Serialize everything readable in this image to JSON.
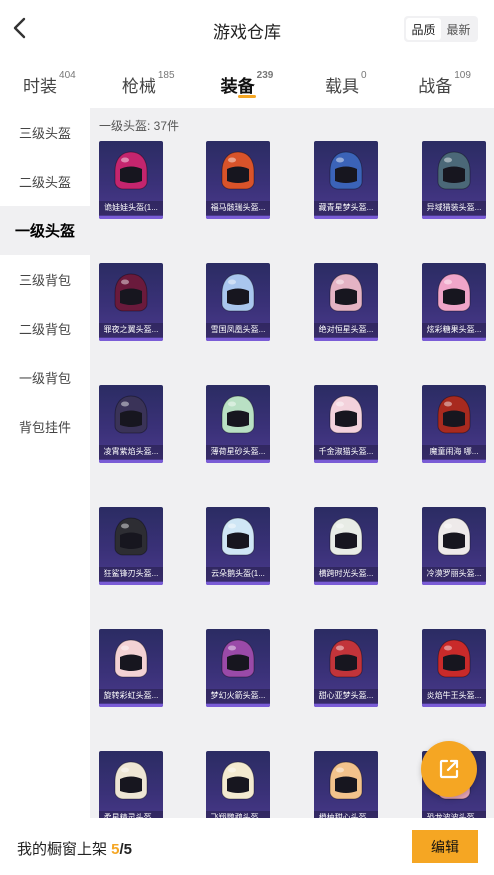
{
  "header": {
    "title": "游戏仓库",
    "back_icon": "chevron-left-icon"
  },
  "sort": {
    "options": [
      "品质",
      "最新"
    ],
    "active": "品质"
  },
  "tabs": [
    {
      "label": "时装",
      "count": "404"
    },
    {
      "label": "枪械",
      "count": "185"
    },
    {
      "label": "装备",
      "count": "239",
      "active": true
    },
    {
      "label": "载具",
      "count": "0"
    },
    {
      "label": "战备",
      "count": "109"
    }
  ],
  "sidebar": {
    "items": [
      "三级头盔",
      "二级头盔",
      "一级头盔",
      "三级背包",
      "二级背包",
      "一级背包",
      "背包挂件"
    ],
    "active": "一级头盔"
  },
  "content": {
    "count_label": "一级头盔: 37件",
    "items": [
      {
        "name": "诡娃娃头盔(1...",
        "color": "#c4256e"
      },
      {
        "name": "福马骸瑞头盔...",
        "color": "#d9532a"
      },
      {
        "name": "藏青星梦头盔...",
        "color": "#3b63b8"
      },
      {
        "name": "异域猎装头盔...",
        "color": "#4b6878"
      },
      {
        "name": "罪夜之翼头盔...",
        "color": "#6a1a3c"
      },
      {
        "name": "雪国凤凰头盔...",
        "color": "#a9c6ee"
      },
      {
        "name": "绝对恒星头盔...",
        "color": "#e4b3c4"
      },
      {
        "name": "炫彩糖果头盔...",
        "color": "#f0a5c9"
      },
      {
        "name": "凌霄紫焰头盔...",
        "color": "#3a3358"
      },
      {
        "name": "薄荷星砂头盔...",
        "color": "#b9e0c4"
      },
      {
        "name": "千金淑猫头盔...",
        "color": "#f3d2dc"
      },
      {
        "name": "魔童闹海 哪...",
        "color": "#a82a1f"
      },
      {
        "name": "狂鲨锋刃头盔...",
        "color": "#2d2d33"
      },
      {
        "name": "云朵鹅头盔(1...",
        "color": "#cfe6f5"
      },
      {
        "name": "横跨时光头盔...",
        "color": "#e8ece6"
      },
      {
        "name": "冷漠罗丽头盔...",
        "color": "#eeeaea"
      },
      {
        "name": "旋转彩虹头盔...",
        "color": "#f3d2d4"
      },
      {
        "name": "梦幻火箭头盔...",
        "color": "#9a4aa8"
      },
      {
        "name": "甜心亚梦头盔...",
        "color": "#c2343a"
      },
      {
        "name": "炎焰牛王头盔...",
        "color": "#c92a2a"
      },
      {
        "name": "柔星精灵头盔...",
        "color": "#eee6d5"
      },
      {
        "name": "飞翔鹦鹉头盔...",
        "color": "#f3ead0"
      },
      {
        "name": "橙柚甜心头盔...",
        "color": "#f2c28c"
      },
      {
        "name": "恐龙波波头盔...",
        "color": "#e7a5b6"
      }
    ]
  },
  "fab": {
    "icon": "share-icon"
  },
  "bottom": {
    "label": "我的橱窗上架 ",
    "current": "5",
    "total": "/5",
    "edit_label": "编辑"
  }
}
